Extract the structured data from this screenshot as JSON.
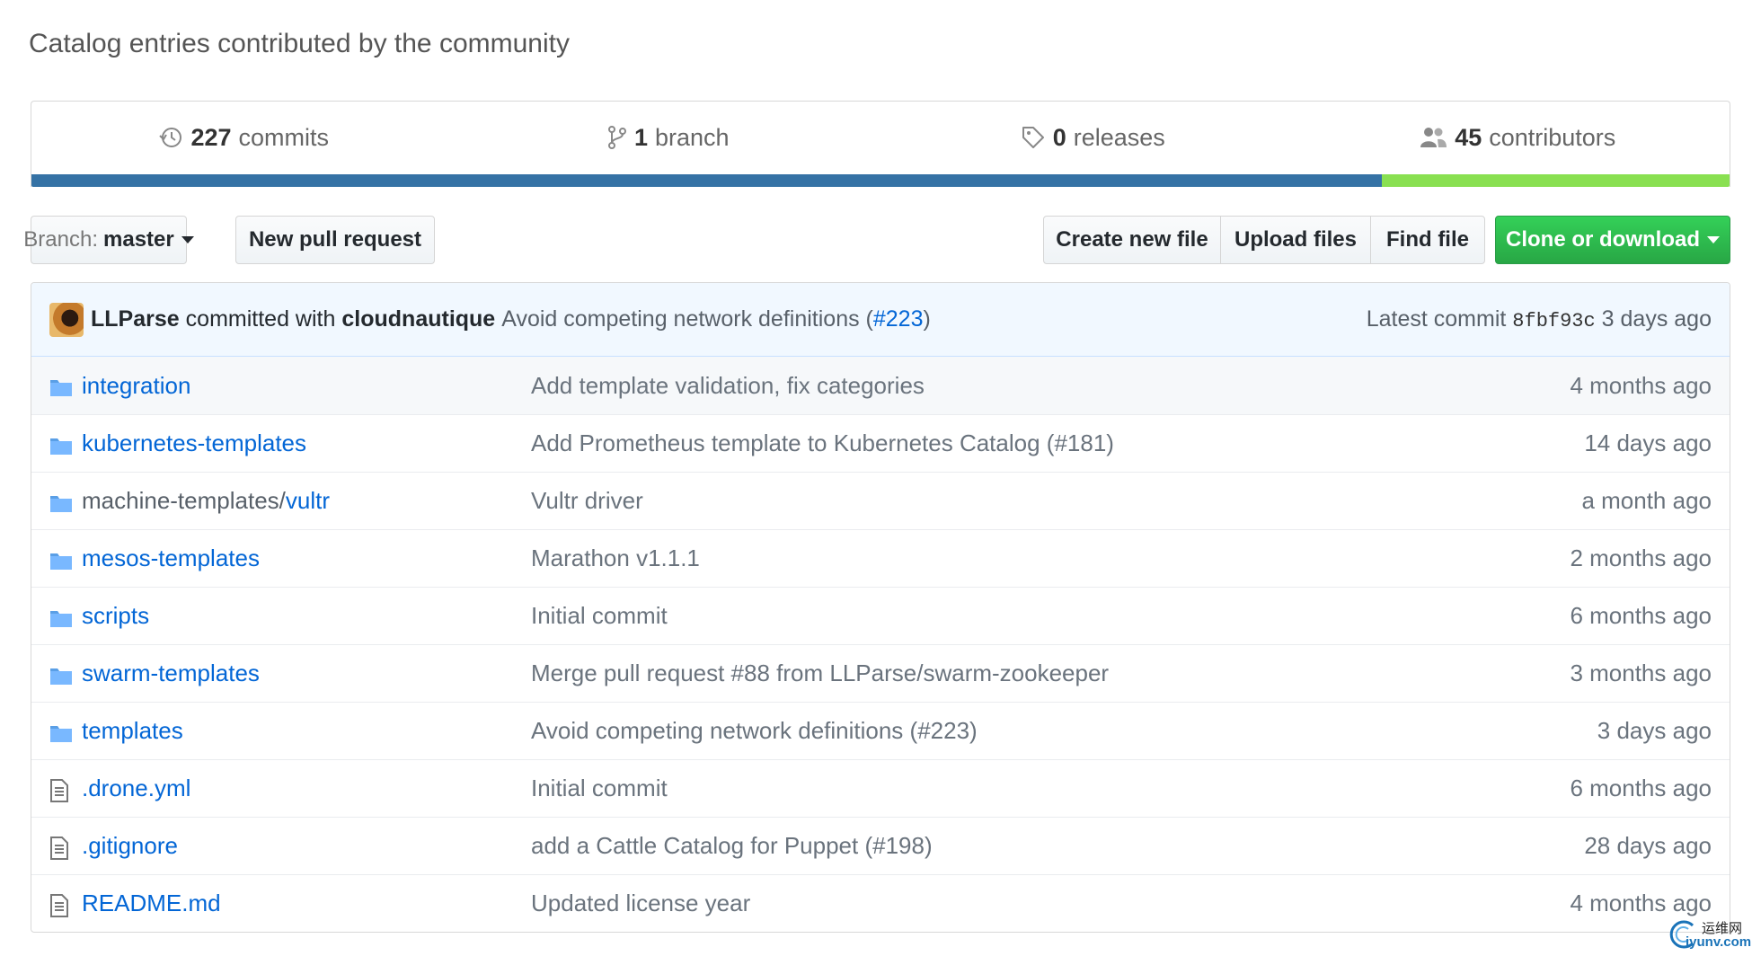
{
  "repo": {
    "description": "Catalog entries contributed by the community"
  },
  "summary": {
    "commits": {
      "count": "227",
      "label": "commits"
    },
    "branches": {
      "count": "1",
      "label": "branch"
    },
    "releases": {
      "count": "0",
      "label": "releases"
    },
    "contributors": {
      "count": "45",
      "label": "contributors"
    }
  },
  "languages": [
    {
      "color": "#3572A5",
      "fraction": 0.795
    },
    {
      "color": "#89e051",
      "fraction": 0.205
    }
  ],
  "toolbar": {
    "branch_label": "Branch:",
    "branch_name": "master",
    "new_pull_request": "New pull request",
    "create_new_file": "Create new file",
    "upload_files": "Upload files",
    "find_file": "Find file",
    "clone_or_download": "Clone or download"
  },
  "latest_commit": {
    "author": "LLParse",
    "committed_with": "committed with",
    "committer": "cloudnautique",
    "message": "Avoid competing network definitions (",
    "pr_link": "#223",
    "message_end": ")",
    "latest_label": "Latest commit",
    "sha": "8fbf93c",
    "age": "3 days ago"
  },
  "files": [
    {
      "type": "dir",
      "name": "integration",
      "message": "Add template validation, fix categories",
      "age": "4 months ago"
    },
    {
      "type": "dir",
      "name": "kubernetes-templates",
      "message": "Add Prometheus template to Kubernetes Catalog (#181)",
      "age": "14 days ago"
    },
    {
      "type": "dir",
      "name_prefix": "machine-templates/",
      "name": "vultr",
      "message": "Vultr driver",
      "age": "a month ago"
    },
    {
      "type": "dir",
      "name": "mesos-templates",
      "message": "Marathon v1.1.1",
      "age": "2 months ago"
    },
    {
      "type": "dir",
      "name": "scripts",
      "message": "Initial commit",
      "age": "6 months ago"
    },
    {
      "type": "dir",
      "name": "swarm-templates",
      "message": "Merge pull request #88 from LLParse/swarm-zookeeper",
      "age": "3 months ago"
    },
    {
      "type": "dir",
      "name": "templates",
      "message": "Avoid competing network definitions (#223)",
      "age": "3 days ago"
    },
    {
      "type": "file",
      "name": ".drone.yml",
      "message": "Initial commit",
      "age": "6 months ago"
    },
    {
      "type": "file",
      "name": ".gitignore",
      "message": "add a Cattle Catalog for Puppet (#198)",
      "age": "28 days ago"
    },
    {
      "type": "file",
      "name": "README.md",
      "message": "Updated license year",
      "age": "4 months ago"
    }
  ],
  "watermark": {
    "top": "运维网",
    "bottom": "iyunv.com"
  }
}
